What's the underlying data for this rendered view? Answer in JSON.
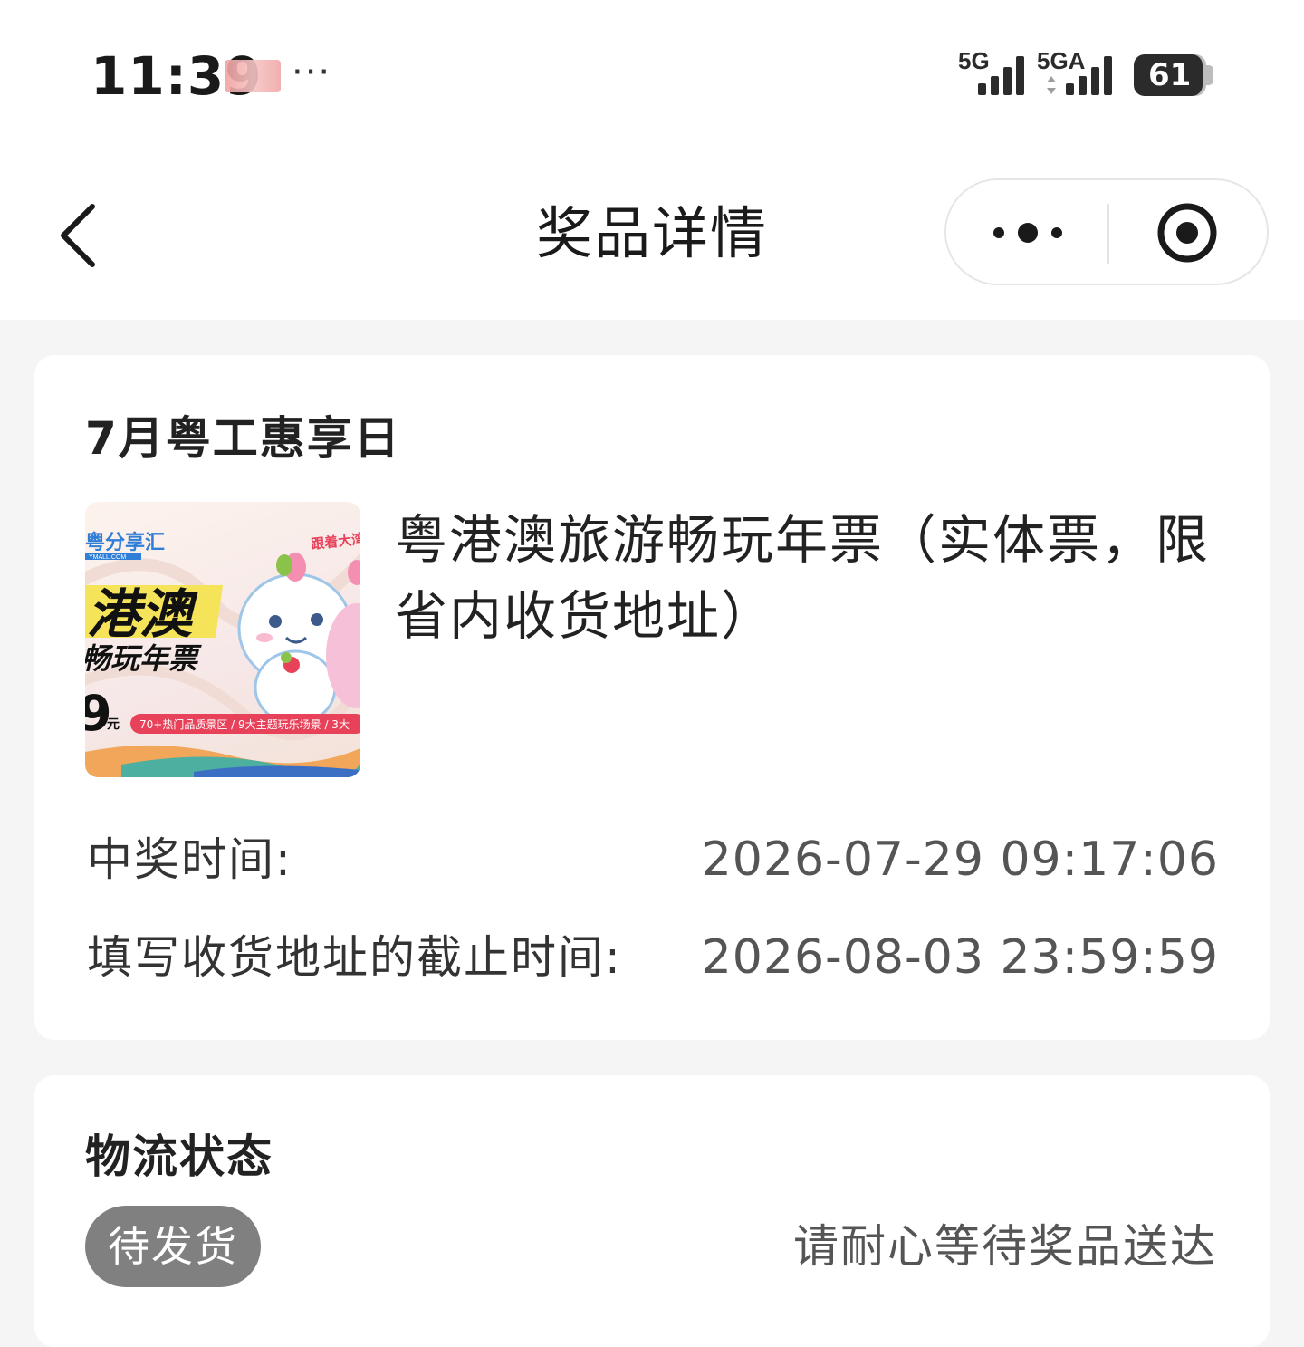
{
  "status_bar": {
    "time": "11:39",
    "more": "···",
    "signal_1_label": "5G",
    "signal_2_label": "5GA",
    "battery": "61",
    "icons": [
      "blurred-notification-icon",
      "signal-5g-icon",
      "signal-5ga-icon",
      "battery-icon"
    ]
  },
  "nav": {
    "title": "奖品详情",
    "icons": [
      "back-chevron-icon",
      "more-dots-icon",
      "close-target-icon"
    ]
  },
  "prize_card": {
    "event_title": "7月粤工惠享日",
    "prize_name": "粤港澳旅游畅玩年票（实体票，限省内收货地址）",
    "thumbnail": {
      "brand": "粤分享汇",
      "brand_sub": "YMALL.COM",
      "headline": "港澳",
      "subheadline": "畅玩年票",
      "price_fragment": "9",
      "price_unit": "元",
      "tag_line": "跟着大湾",
      "banner": "70+热门品质景区 / 9大主题玩乐场景 / 3大"
    },
    "win_time_label": "中奖时间:",
    "win_time_value": "2026-07-29 09:17:06",
    "deadline_label": "填写收货地址的截止时间:",
    "deadline_value": "2026-08-03 23:59:59"
  },
  "logistics": {
    "title": "物流状态",
    "status": "待发货",
    "hint": "请耐心等待奖品送达"
  },
  "colors": {
    "page_bg": "#f5f5f5",
    "card_bg": "#ffffff",
    "badge_bg": "#808080",
    "banner_red": "#e8425a"
  }
}
